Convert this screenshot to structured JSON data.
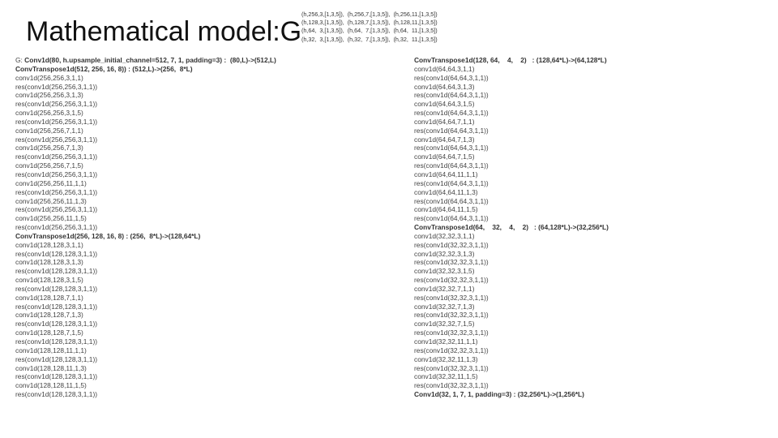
{
  "title": "Mathematical model:G",
  "notes": [
    "(h,256,3,[1,3,5]),  (h,256,7,[1,3,5]),  (h,256,11,[1,3,5])",
    "(h,128,3,[1,3,5]),  (h,128,7,[1,3,5]),  (h,128,11,[1,3,5])",
    "(h,64,  3,[1,3,5]),  (h,64,  7,[1,3,5]),  (h,64,  11,[1,3,5])",
    "(h,32,  3,[1,3,5]),  (h,32,  7,[1,3,5]),  (h,32,  11,[1,3,5])"
  ],
  "left_column": [
    {
      "prefix": "G: ",
      "text": "Conv1d(80, h.upsample_initial_channel=512, 7, 1, padding=3) :  (80,L)->(512,L)",
      "bold": true
    },
    {
      "text": "ConvTranspose1d(512, 256, 16, 8)) : (512,L)->(256,  8*L)",
      "bold": true
    },
    {
      "text": "conv1d(256,256,3,1,1)"
    },
    {
      "text": "res(conv1d(256,256,3,1,1))"
    },
    {
      "text": "conv1d(256,256,3,1,3)"
    },
    {
      "text": "res(conv1d(256,256,3,1,1))"
    },
    {
      "text": "conv1d(256,256,3,1,5)"
    },
    {
      "text": "res(conv1d(256,256,3,1,1))"
    },
    {
      "text": "conv1d(256,256,7,1,1)"
    },
    {
      "text": "res(conv1d(256,256,3,1,1))"
    },
    {
      "text": "conv1d(256,256,7,1,3)"
    },
    {
      "text": "res(conv1d(256,256,3,1,1))"
    },
    {
      "text": "conv1d(256,256,7,1,5)"
    },
    {
      "text": "res(conv1d(256,256,3,1,1))"
    },
    {
      "text": "conv1d(256,256,11,1,1)"
    },
    {
      "text": "res(conv1d(256,256,3,1,1))"
    },
    {
      "text": "conv1d(256,256,11,1,3)"
    },
    {
      "text": "res(conv1d(256,256,3,1,1))"
    },
    {
      "text": "conv1d(256,256,11,1,5)"
    },
    {
      "text": "res(conv1d(256,256,3,1,1))"
    },
    {
      "text": "ConvTranspose1d(256, 128, 16, 8) : (256,  8*L)->(128,64*L)",
      "bold": true
    },
    {
      "text": "conv1d(128,128,3,1,1)"
    },
    {
      "text": "res(conv1d(128,128,3,1,1))"
    },
    {
      "text": "conv1d(128,128,3,1,3)"
    },
    {
      "text": "res(conv1d(128,128,3,1,1))"
    },
    {
      "text": "conv1d(128,128,3,1,5)"
    },
    {
      "text": "res(conv1d(128,128,3,1,1))"
    },
    {
      "text": "conv1d(128,128,7,1,1)"
    },
    {
      "text": "res(conv1d(128,128,3,1,1))"
    },
    {
      "text": "conv1d(128,128,7,1,3)"
    },
    {
      "text": "res(conv1d(128,128,3,1,1))"
    },
    {
      "text": "conv1d(128,128,7,1,5)"
    },
    {
      "text": "res(conv1d(128,128,3,1,1))"
    },
    {
      "text": "conv1d(128,128,11,1,1)"
    },
    {
      "text": "res(conv1d(128,128,3,1,1))"
    },
    {
      "text": "conv1d(128,128,11,1,3)"
    },
    {
      "text": "res(conv1d(128,128,3,1,1))"
    },
    {
      "text": "conv1d(128,128,11,1,5)"
    },
    {
      "text": "res(conv1d(128,128,3,1,1))"
    }
  ],
  "right_column": [
    {
      "text": "ConvTranspose1d(128, 64,    4,    2)   : (128,64*L)->(64,128*L)",
      "bold": true
    },
    {
      "text": "conv1d(64,64,3,1,1)"
    },
    {
      "text": "res(conv1d(64,64,3,1,1))"
    },
    {
      "text": "conv1d(64,64,3,1,3)"
    },
    {
      "text": "res(conv1d(64,64,3,1,1))"
    },
    {
      "text": "conv1d(64,64,3,1,5)"
    },
    {
      "text": "res(conv1d(64,64,3,1,1))"
    },
    {
      "text": "conv1d(64,64,7,1,1)"
    },
    {
      "text": "res(conv1d(64,64,3,1,1))"
    },
    {
      "text": "conv1d(64,64,7,1,3)"
    },
    {
      "text": "res(conv1d(64,64,3,1,1))"
    },
    {
      "text": "conv1d(64,64,7,1,5)"
    },
    {
      "text": "res(conv1d(64,64,3,1,1))"
    },
    {
      "text": "conv1d(64,64,11,1,1)"
    },
    {
      "text": "res(conv1d(64,64,3,1,1))"
    },
    {
      "text": "conv1d(64,64,11,1,3)"
    },
    {
      "text": "res(conv1d(64,64,3,1,1))"
    },
    {
      "text": "conv1d(64,64,11,1,5)"
    },
    {
      "text": "res(conv1d(64,64,3,1,1))"
    },
    {
      "text": "ConvTranspose1d(64,    32,    4,    2)   : (64,128*L)->(32,256*L)",
      "bold": true
    },
    {
      "text": "conv1d(32,32,3,1,1)"
    },
    {
      "text": "res(conv1d(32,32,3,1,1))"
    },
    {
      "text": "conv1d(32,32,3,1,3)"
    },
    {
      "text": "res(conv1d(32,32,3,1,1))"
    },
    {
      "text": "conv1d(32,32,3,1,5)"
    },
    {
      "text": "res(conv1d(32,32,3,1,1))"
    },
    {
      "text": "conv1d(32,32,7,1,1)"
    },
    {
      "text": "res(conv1d(32,32,3,1,1))"
    },
    {
      "text": "conv1d(32,32,7,1,3)"
    },
    {
      "text": "res(conv1d(32,32,3,1,1))"
    },
    {
      "text": "conv1d(32,32,7,1,5)"
    },
    {
      "text": "res(conv1d(32,32,3,1,1))"
    },
    {
      "text": "conv1d(32,32,11,1,1)"
    },
    {
      "text": "res(conv1d(32,32,3,1,1))"
    },
    {
      "text": "conv1d(32,32,11,1,3)"
    },
    {
      "text": "res(conv1d(32,32,3,1,1))"
    },
    {
      "text": "conv1d(32,32,11,1,5)"
    },
    {
      "text": "res(conv1d(32,32,3,1,1))"
    },
    {
      "text": "Conv1d(32, 1, 7, 1, padding=3) : (32,256*L)->(1,256*L)",
      "bold": true
    }
  ]
}
